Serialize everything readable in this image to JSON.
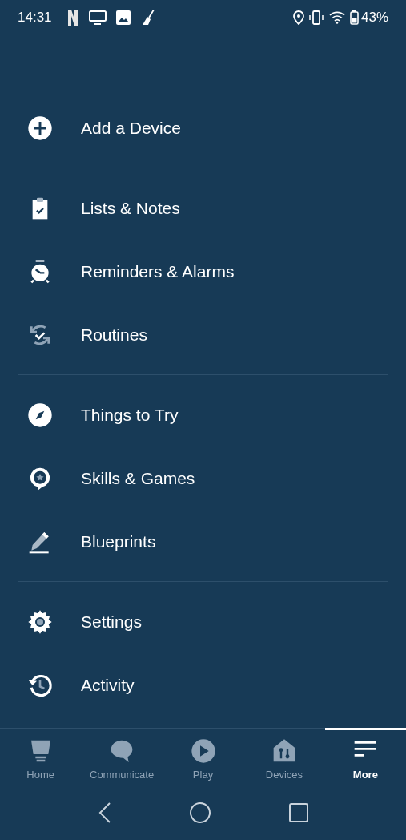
{
  "status_bar": {
    "time": "14:31",
    "battery": "43%"
  },
  "menu_groups": [
    {
      "items": [
        {
          "label": "Add a Device"
        }
      ]
    },
    {
      "items": [
        {
          "label": "Lists & Notes"
        },
        {
          "label": "Reminders & Alarms"
        },
        {
          "label": "Routines"
        }
      ]
    },
    {
      "items": [
        {
          "label": "Things to Try"
        },
        {
          "label": "Skills & Games"
        },
        {
          "label": "Blueprints"
        }
      ]
    },
    {
      "items": [
        {
          "label": "Settings"
        },
        {
          "label": "Activity"
        }
      ]
    }
  ],
  "bottom_tabs": [
    {
      "label": "Home",
      "selected": false
    },
    {
      "label": "Communicate",
      "selected": false
    },
    {
      "label": "Play",
      "selected": false
    },
    {
      "label": "Devices",
      "selected": false
    },
    {
      "label": "More",
      "selected": true
    }
  ]
}
